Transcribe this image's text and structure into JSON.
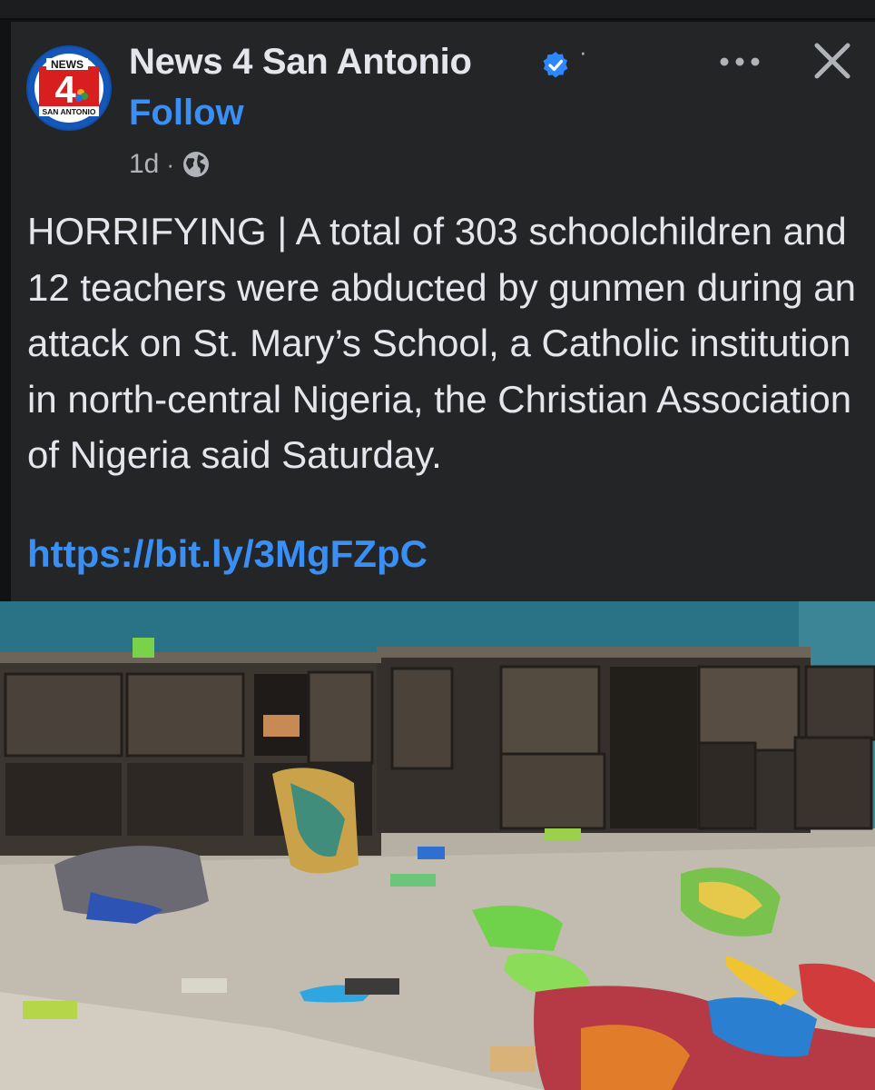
{
  "post": {
    "page_name": "News 4 San Antonio",
    "follow_label": "Follow",
    "time": "1d",
    "separator": "·",
    "body": "HORRIFYING | A total of 303 schoolchildren and 12 teachers were abducted by gunmen during an attack on St. Mary’s School, a Catholic institution in north-central Nigeria, the Christian Association of Nigeria said Saturday.",
    "link": "https://bit.ly/3MgFZpC"
  },
  "logo": {
    "top_text": "NEWS",
    "number": "4",
    "bottom_text": "SAN ANTONIO"
  },
  "icons": {
    "verified": "verified-badge-icon",
    "globe": "globe-icon",
    "more": "more-options-icon",
    "close": "close-icon"
  },
  "colors": {
    "card_bg": "#242526",
    "text": "#e4e6eb",
    "secondary": "#b0b3b8",
    "link": "#3a8ff5",
    "verified": "#2d88ff"
  }
}
